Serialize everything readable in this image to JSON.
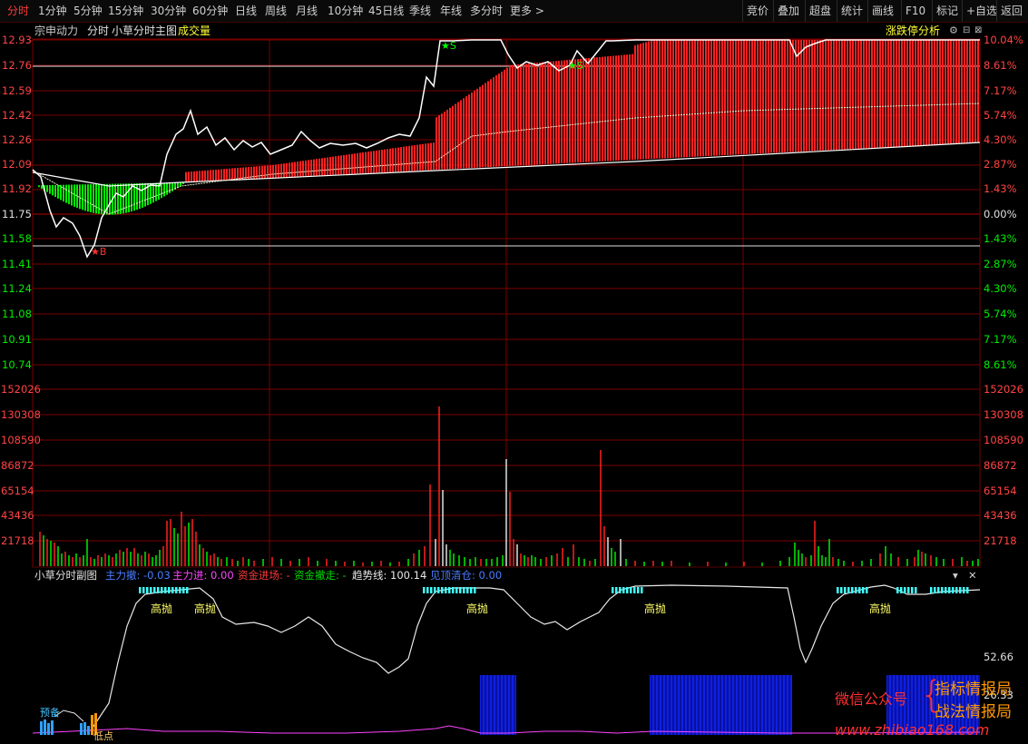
{
  "toolbar": {
    "left": [
      "分时",
      "1分钟",
      "5分钟",
      "15分钟",
      "30分钟",
      "60分钟",
      "日线",
      "周线",
      "月线",
      "10分钟",
      "45日线",
      "季线",
      "年线",
      "多分时",
      "更多 >"
    ],
    "active_index": 0,
    "right": [
      "竞价",
      "叠加",
      "超盘",
      "统计",
      "画线",
      "F10",
      "标记",
      "+自选",
      "返回"
    ]
  },
  "header": {
    "stock": "宗申动力",
    "mode": "分时",
    "indicator": "小草分时主图",
    "volume": "成交量",
    "analysis": "涨跌停分析",
    "icons": [
      "settings-icon",
      "minus-icon",
      "close-icon"
    ]
  },
  "price_axis": {
    "left": [
      "12.93",
      "12.76",
      "12.59",
      "12.42",
      "12.26",
      "12.09",
      "11.92",
      "11.75",
      "11.58",
      "11.41",
      "11.24",
      "11.08",
      "10.91",
      "10.74"
    ],
    "right": [
      "10.04%",
      "8.61%",
      "7.17%",
      "5.74%",
      "4.30%",
      "2.87%",
      "1.43%",
      "0.00%",
      "1.43%",
      "2.87%",
      "4.30%",
      "5.74%",
      "7.17%",
      "8.61%"
    ]
  },
  "volume_axis": [
    "152026",
    "130308",
    "108590",
    "86872",
    "65154",
    "43436",
    "21718"
  ],
  "sub_header": {
    "name": "小草分时副图",
    "items": [
      {
        "label": "主力撤: -0.03",
        "color": "#4a7dff"
      },
      {
        "label": "主力进: 0.00",
        "color": "#ff44ff"
      },
      {
        "label": "资金进场: -",
        "color": "#ff3b3b"
      },
      {
        "label": "资金撤走: -",
        "color": "#00dd00"
      },
      {
        "label": "趋势线: 100.14",
        "color": "#e8e8e8"
      },
      {
        "label": "见顶清仓: 0.00",
        "color": "#4a7dff"
      }
    ]
  },
  "sub_axis": [
    "52.66",
    "26.33"
  ],
  "marks": {
    "buy": "B",
    "sell": "S"
  },
  "annotations": {
    "sell_high": "高抛",
    "pre": "预备",
    "low": "低点"
  },
  "watermark": {
    "wechat": "微信公众号",
    "line1": "指标情报局",
    "line2": "战法情报局",
    "url": "www.zhibiao168.com"
  },
  "colors": {
    "up": "#ff2020",
    "down": "#00ee00",
    "grid": "#7a0000",
    "axis_up": "#ff4444",
    "axis_down": "#00ee00",
    "volume_label": "#ff4444"
  }
}
